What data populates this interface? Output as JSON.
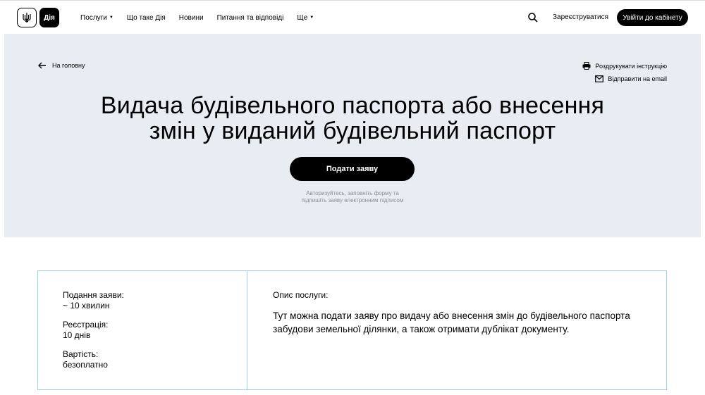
{
  "header": {
    "logo_text": "Дія",
    "nav": [
      {
        "label": "Послуги",
        "dropdown": true
      },
      {
        "label": "Що таке Дія",
        "dropdown": false
      },
      {
        "label": "Новини",
        "dropdown": false
      },
      {
        "label": "Питання та відповіді",
        "dropdown": false
      },
      {
        "label": "Ще",
        "dropdown": true
      }
    ],
    "register_label": "Зареєструватися",
    "login_label": "Увійти до кабінету"
  },
  "hero": {
    "back_label": "На головну",
    "print_label": "Роздрукувати інструкцію",
    "email_label": "Відправити на email",
    "title_line1": "Видача будівельного паспорта або внесення",
    "title_line2": "змін у виданий будівельний паспорт",
    "submit_label": "Подати заяву",
    "hint_line1": "Авторизуйтесь, заповніть форму та",
    "hint_line2": "підпишіть заяву електронним підписом"
  },
  "info": {
    "items": [
      {
        "label": "Подання заяви:",
        "value": "~ 10 хвилин"
      },
      {
        "label": "Реєстрація:",
        "value": "10 днів"
      },
      {
        "label": "Вартість:",
        "value": "безоплатно"
      }
    ],
    "description_label": "Опис послуги:",
    "description": "Тут можна подати заяву про видачу або внесення змін до будівельного паспорта забудови земельної ділянки, а також отримати дублікат документу."
  },
  "colors": {
    "hero_bg": "#e8edf3",
    "card_border": "#9fd3d6",
    "button_bg": "#000000"
  }
}
